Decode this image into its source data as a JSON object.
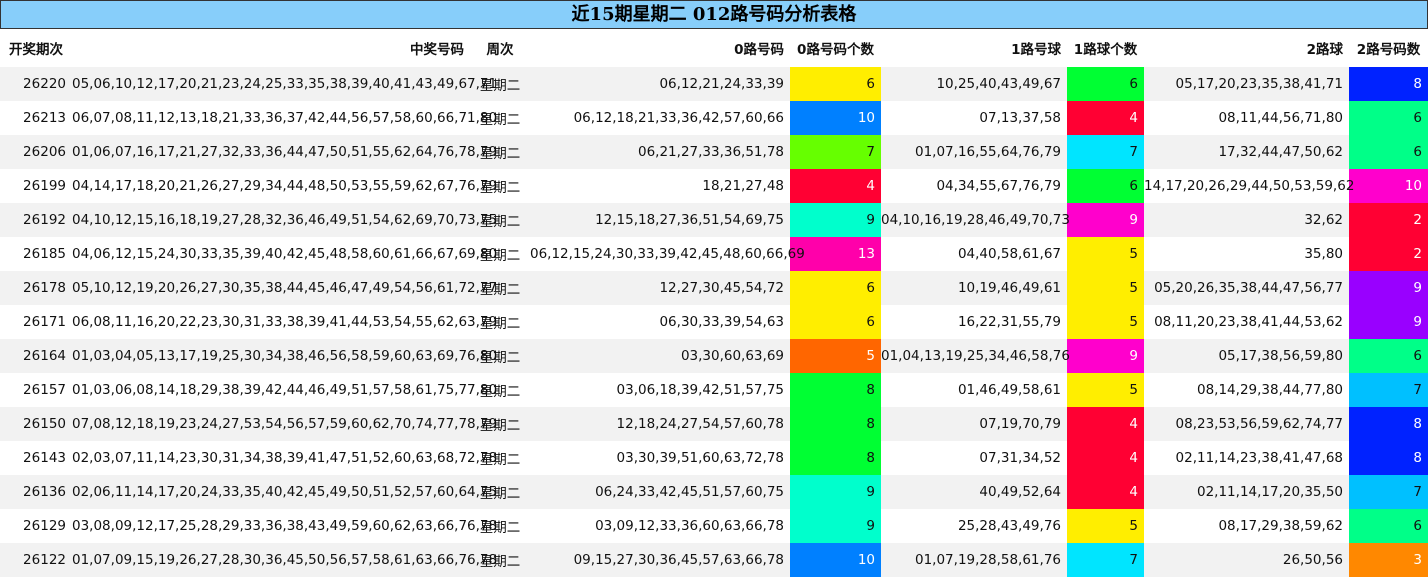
{
  "title": "近15期星期二 012路号码分析表格",
  "headers": [
    "开奖期次",
    "中奖号码",
    "周次",
    "0路号码",
    "0路号码个数",
    "1路号球",
    "1路球个数",
    "2路球",
    "2路号码数"
  ],
  "rows": [
    {
      "period": "26220",
      "numbers": "05,06,10,12,17,20,21,23,24,25,33,35,38,39,40,41,43,49,67,71",
      "week": "星期二",
      "r0": "06,12,21,24,33,39",
      "c0": "6",
      "r1": "10,25,40,43,49,67",
      "c1": "6",
      "r2": "05,17,20,23,35,38,41,71",
      "c2": "8"
    },
    {
      "period": "26213",
      "numbers": "06,07,08,11,12,13,18,21,33,36,37,42,44,56,57,58,60,66,71,80",
      "week": "星期二",
      "r0": "06,12,18,21,33,36,42,57,60,66",
      "c0": "10",
      "r1": "07,13,37,58",
      "c1": "4",
      "r2": "08,11,44,56,71,80",
      "c2": "6"
    },
    {
      "period": "26206",
      "numbers": "01,06,07,16,17,21,27,32,33,36,44,47,50,51,55,62,64,76,78,79",
      "week": "星期二",
      "r0": "06,21,27,33,36,51,78",
      "c0": "7",
      "r1": "01,07,16,55,64,76,79",
      "c1": "7",
      "r2": "17,32,44,47,50,62",
      "c2": "6"
    },
    {
      "period": "26199",
      "numbers": "04,14,17,18,20,21,26,27,29,34,44,48,50,53,55,59,62,67,76,79",
      "week": "星期二",
      "r0": "18,21,27,48",
      "c0": "4",
      "r1": "04,34,55,67,76,79",
      "c1": "6",
      "r2": "14,17,20,26,29,44,50,53,59,62",
      "c2": "10"
    },
    {
      "period": "26192",
      "numbers": "04,10,12,15,16,18,19,27,28,32,36,46,49,51,54,62,69,70,73,75",
      "week": "星期二",
      "r0": "12,15,18,27,36,51,54,69,75",
      "c0": "9",
      "r1": "04,10,16,19,28,46,49,70,73",
      "c1": "9",
      "r2": "32,62",
      "c2": "2"
    },
    {
      "period": "26185",
      "numbers": "04,06,12,15,24,30,33,35,39,40,42,45,48,58,60,61,66,67,69,80",
      "week": "星期二",
      "r0": "06,12,15,24,30,33,39,42,45,48,60,66,69",
      "c0": "13",
      "r1": "04,40,58,61,67",
      "c1": "5",
      "r2": "35,80",
      "c2": "2"
    },
    {
      "period": "26178",
      "numbers": "05,10,12,19,20,26,27,30,35,38,44,45,46,47,49,54,56,61,72,77",
      "week": "星期二",
      "r0": "12,27,30,45,54,72",
      "c0": "6",
      "r1": "10,19,46,49,61",
      "c1": "5",
      "r2": "05,20,26,35,38,44,47,56,77",
      "c2": "9"
    },
    {
      "period": "26171",
      "numbers": "06,08,11,16,20,22,23,30,31,33,38,39,41,44,53,54,55,62,63,79",
      "week": "星期二",
      "r0": "06,30,33,39,54,63",
      "c0": "6",
      "r1": "16,22,31,55,79",
      "c1": "5",
      "r2": "08,11,20,23,38,41,44,53,62",
      "c2": "9"
    },
    {
      "period": "26164",
      "numbers": "01,03,04,05,13,17,19,25,30,34,38,46,56,58,59,60,63,69,76,80",
      "week": "星期二",
      "r0": "03,30,60,63,69",
      "c0": "5",
      "r1": "01,04,13,19,25,34,46,58,76",
      "c1": "9",
      "r2": "05,17,38,56,59,80",
      "c2": "6"
    },
    {
      "period": "26157",
      "numbers": "01,03,06,08,14,18,29,38,39,42,44,46,49,51,57,58,61,75,77,80",
      "week": "星期二",
      "r0": "03,06,18,39,42,51,57,75",
      "c0": "8",
      "r1": "01,46,49,58,61",
      "c1": "5",
      "r2": "08,14,29,38,44,77,80",
      "c2": "7"
    },
    {
      "period": "26150",
      "numbers": "07,08,12,18,19,23,24,27,53,54,56,57,59,60,62,70,74,77,78,79",
      "week": "星期二",
      "r0": "12,18,24,27,54,57,60,78",
      "c0": "8",
      "r1": "07,19,70,79",
      "c1": "4",
      "r2": "08,23,53,56,59,62,74,77",
      "c2": "8"
    },
    {
      "period": "26143",
      "numbers": "02,03,07,11,14,23,30,31,34,38,39,41,47,51,52,60,63,68,72,78",
      "week": "星期二",
      "r0": "03,30,39,51,60,63,72,78",
      "c0": "8",
      "r1": "07,31,34,52",
      "c1": "4",
      "r2": "02,11,14,23,38,41,47,68",
      "c2": "8"
    },
    {
      "period": "26136",
      "numbers": "02,06,11,14,17,20,24,33,35,40,42,45,49,50,51,52,57,60,64,75",
      "week": "星期二",
      "r0": "06,24,33,42,45,51,57,60,75",
      "c0": "9",
      "r1": "40,49,52,64",
      "c1": "4",
      "r2": "02,11,14,17,20,35,50",
      "c2": "7"
    },
    {
      "period": "26129",
      "numbers": "03,08,09,12,17,25,28,29,33,36,38,43,49,59,60,62,63,66,76,78",
      "week": "星期二",
      "r0": "03,09,12,33,36,60,63,66,78",
      "c0": "9",
      "r1": "25,28,43,49,76",
      "c1": "5",
      "r2": "08,17,29,38,59,62",
      "c2": "6"
    },
    {
      "period": "26122",
      "numbers": "01,07,09,15,19,26,27,28,30,36,45,50,56,57,58,61,63,66,76,78",
      "week": "星期二",
      "r0": "09,15,27,30,36,45,57,63,66,78",
      "c0": "10",
      "r1": "01,07,19,28,58,61,76",
      "c1": "7",
      "r2": "26,50,56",
      "c2": "3"
    }
  ],
  "count_colors": {
    "2": {
      "bg": "#ff0033",
      "fg": "#ffffff"
    },
    "3": {
      "bg": "#ff8000",
      "fg": "#ffffff"
    },
    "4": {
      "bg": "#ff0033",
      "fg": "#ffffff"
    },
    "5": {
      "bg": "#ffee00",
      "fg": "#111111"
    },
    "6": {
      "bg": "#ffee00",
      "fg": "#111111"
    },
    "7": {
      "bg": "#00e5ff",
      "fg": "#111111"
    },
    "8": {
      "bg": "#00ff33",
      "fg": "#111111"
    },
    "9": {
      "bg": "#00ffcc",
      "fg": "#111111"
    },
    "10": {
      "bg": "#0080ff",
      "fg": "#ffffff"
    },
    "13": {
      "bg": "#ff00aa",
      "fg": "#ffffff"
    }
  },
  "col_overrides": {
    "c0": {
      "5": {
        "bg": "#ff6600",
        "fg": "#ffffff"
      },
      "7": {
        "bg": "#66ff00",
        "fg": "#111111"
      },
      "4": {
        "bg": "#ff0033",
        "fg": "#ffffff"
      },
      "13": {
        "bg": "#ff00aa",
        "fg": "#ffffff"
      }
    },
    "c1": {
      "6": {
        "bg": "#00ff33",
        "fg": "#111111"
      },
      "9": {
        "bg": "#ff00cc",
        "fg": "#ffffff"
      },
      "7": {
        "bg": "#00e5ff",
        "fg": "#111111"
      },
      "5": {
        "bg": "#ffee00",
        "fg": "#111111"
      },
      "4": {
        "bg": "#ff0033",
        "fg": "#ffffff"
      }
    },
    "c2": {
      "8": {
        "bg": "#0022ff",
        "fg": "#ffffff"
      },
      "6": {
        "bg": "#00ff88",
        "fg": "#111111"
      },
      "10": {
        "bg": "#ff00cc",
        "fg": "#ffffff"
      },
      "2": {
        "bg": "#ff0033",
        "fg": "#ffffff"
      },
      "9": {
        "bg": "#9900ff",
        "fg": "#ffffff"
      },
      "7": {
        "bg": "#00c0ff",
        "fg": "#111111"
      },
      "3": {
        "bg": "#ff8800",
        "fg": "#ffffff"
      }
    }
  }
}
